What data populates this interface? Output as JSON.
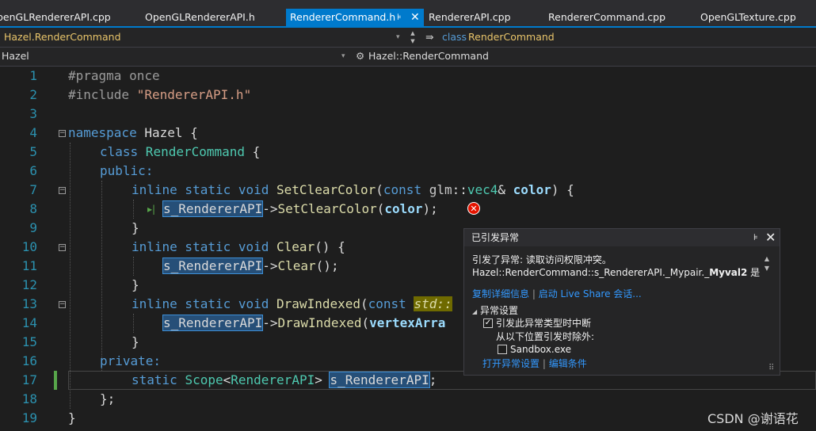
{
  "tabs": [
    {
      "label": "penGLRendererAPI.cpp",
      "active": false
    },
    {
      "label": "OpenGLRendererAPI.h",
      "active": false
    },
    {
      "label": "RendererCommand.h",
      "active": true
    },
    {
      "label": "RendererAPI.cpp",
      "active": false
    },
    {
      "label": "RendererCommand.cpp",
      "active": false
    },
    {
      "label": "OpenGLTexture.cpp",
      "active": false
    }
  ],
  "tab_pin_icon": "⊧",
  "tab_close_icon": "✕",
  "nav": {
    "project": "Hazel.RenderCommand",
    "member_prefix": "class",
    "member_name": "RenderCommand",
    "scope": "Hazel",
    "scope_member": "Hazel::RenderCommand"
  },
  "line_numbers": [
    "1",
    "2",
    "3",
    "4",
    "5",
    "6",
    "7",
    "8",
    "9",
    "10",
    "11",
    "12",
    "13",
    "14",
    "15",
    "16",
    "17",
    "18",
    "19"
  ],
  "code": {
    "l1": "#pragma once",
    "l2_a": "#include ",
    "l2_b": "\"RendererAPI.h\"",
    "l4_kw": "namespace",
    "l4_name": " Hazel ",
    "l4_brace": "{",
    "l5_kw": "class",
    "l5_name": " RenderCommand ",
    "l5_brace": "{",
    "l6": "public:",
    "l7_kw": "inline static void ",
    "l7_fn": "SetClearColor",
    "l7_open": "(",
    "l7_const": "const ",
    "l7_ns": "glm",
    "l7_sep": "::",
    "l7_ty": "vec4",
    "l7_amp": "& ",
    "l7_par": "color",
    "l7_close": ") {",
    "l8_var": "s_RendererAPI",
    "l8_arrow": "->",
    "l8_fn": "SetClearColor",
    "l8_open": "(",
    "l8_par": "color",
    "l8_close": ");",
    "l9": "}",
    "l10_kw": "inline static void ",
    "l10_fn": "Clear",
    "l10_rest": "() {",
    "l11_var": "s_RendererAPI",
    "l11_arrow": "->",
    "l11_fn": "Clear",
    "l11_rest": "();",
    "l12": "}",
    "l13_kw": "inline static void ",
    "l13_fn": "DrawIndexed",
    "l13_open": "(",
    "l13_const": "const ",
    "l13_std": "std::",
    "l14_var": "s_RendererAPI",
    "l14_arrow": "->",
    "l14_fn": "DrawIndexed",
    "l14_open": "(",
    "l14_par": "vertexArra",
    "l15": "}",
    "l16": "private:",
    "l17_kw": "static ",
    "l17_ty": "Scope",
    "l17_lt": "<",
    "l17_arg": "RendererAPI",
    "l17_gt": "> ",
    "l17_var": "s_RendererAPI",
    "l17_end": ";",
    "l18": "};",
    "l19": "}"
  },
  "error_glyph_icon": "✕",
  "popup": {
    "title": "已引发异常",
    "pin_icon": "⊧",
    "close_icon": "✕",
    "message_line1": "引发了异常: 读取访问权限冲突。",
    "message_line2_a": "Hazel::RenderCommand::s_RendererAPI._Mypair._",
    "message_line2_b": "Myval2",
    "message_line2_c": " 是",
    "link_copy": "复制详细信息",
    "divider": "|",
    "link_liveshare": "启动 Live Share 会话...",
    "settings_header": "异常设置",
    "settings_caret": "◢",
    "check1_label": "引发此异常类型时中断",
    "check1_checked": true,
    "except_label": "从以下位置引发时除外:",
    "check2_label": "Sandbox.exe",
    "check2_checked": false,
    "link_open": "打开异常设置",
    "link_edit": "编辑条件",
    "scroll_up": "▲",
    "scroll_down": "▼",
    "grip": "⠿"
  },
  "watermark": "CSDN @谢语花"
}
